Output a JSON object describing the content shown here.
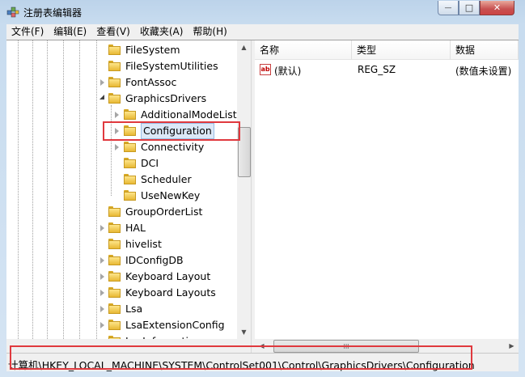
{
  "window": {
    "title": "注册表编辑器",
    "min_glyph": "—",
    "max_glyph": "□",
    "close_glyph": "✕"
  },
  "menu": [
    {
      "label": "文件(F)"
    },
    {
      "label": "编辑(E)"
    },
    {
      "label": "查看(V)"
    },
    {
      "label": "收藏夹(A)"
    },
    {
      "label": "帮助(H)"
    }
  ],
  "tree": {
    "items": [
      {
        "label": "FileSystem",
        "level": 1,
        "expander": "none"
      },
      {
        "label": "FileSystemUtilities",
        "level": 1,
        "expander": "none"
      },
      {
        "label": "FontAssoc",
        "level": 1,
        "expander": "closed"
      },
      {
        "label": "GraphicsDrivers",
        "level": 1,
        "expander": "open"
      },
      {
        "label": "AdditionalModeLists",
        "level": 2,
        "expander": "closed"
      },
      {
        "label": "Configuration",
        "level": 2,
        "expander": "closed",
        "selected": true
      },
      {
        "label": "Connectivity",
        "level": 2,
        "expander": "closed"
      },
      {
        "label": "DCI",
        "level": 2,
        "expander": "none"
      },
      {
        "label": "Scheduler",
        "level": 2,
        "expander": "none"
      },
      {
        "label": "UseNewKey",
        "level": 2,
        "expander": "none"
      },
      {
        "label": "GroupOrderList",
        "level": 1,
        "expander": "none"
      },
      {
        "label": "HAL",
        "level": 1,
        "expander": "closed"
      },
      {
        "label": "hivelist",
        "level": 1,
        "expander": "none"
      },
      {
        "label": "IDConfigDB",
        "level": 1,
        "expander": "closed"
      },
      {
        "label": "Keyboard Layout",
        "level": 1,
        "expander": "closed"
      },
      {
        "label": "Keyboard Layouts",
        "level": 1,
        "expander": "closed"
      },
      {
        "label": "Lsa",
        "level": 1,
        "expander": "closed"
      },
      {
        "label": "LsaExtensionConfig",
        "level": 1,
        "expander": "closed"
      },
      {
        "label": "LsaInformation",
        "level": 1,
        "expander": "none"
      }
    ]
  },
  "list": {
    "columns": [
      {
        "label": "名称"
      },
      {
        "label": "类型"
      },
      {
        "label": "数据"
      }
    ],
    "rows": [
      {
        "name": "(默认)",
        "type": "REG_SZ",
        "data": "(数值未设置)",
        "icon_text": "ab"
      }
    ]
  },
  "scroll": {
    "up": "▲",
    "down": "▼",
    "left": "◀",
    "right": "▶",
    "grip": "III"
  },
  "status": {
    "path": "计算机\\HKEY_LOCAL_MACHINE\\SYSTEM\\ControlSet001\\Control\\GraphicsDrivers\\Configuration"
  },
  "colors": {
    "highlight": "#e0393e",
    "selection_bg": "#dbe8f7",
    "folder": "#f2c94c"
  }
}
